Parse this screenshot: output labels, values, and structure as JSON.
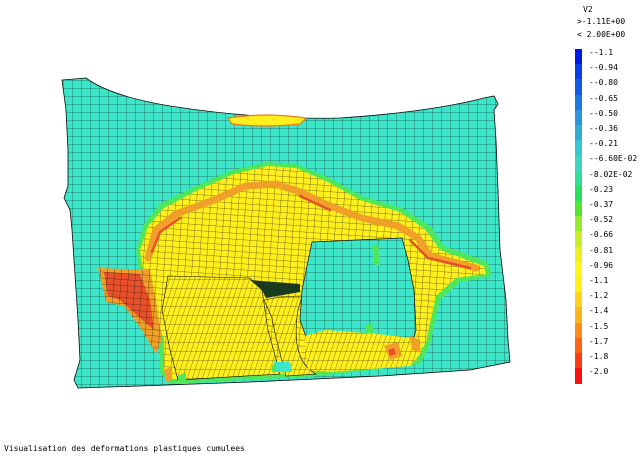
{
  "legend": {
    "variable": "V2",
    "min_label": ">-1.11E+00",
    "max_label": "< 2.00E+00",
    "levels": [
      {
        "label": "-1.1",
        "color": "#0019e6"
      },
      {
        "label": "-0.94",
        "color": "#0a3ee6"
      },
      {
        "label": "-0.80",
        "color": "#1659e6"
      },
      {
        "label": "-0.65",
        "color": "#1f78e0"
      },
      {
        "label": "-0.50",
        "color": "#2b94db"
      },
      {
        "label": "-0.36",
        "color": "#33acd3"
      },
      {
        "label": "-0.21",
        "color": "#35c7d2"
      },
      {
        "label": "-6.60E-02",
        "color": "#3ed6c0"
      },
      {
        "label": "8.02E-02",
        "color": "#2fe096"
      },
      {
        "label": "0.23",
        "color": "#26e060"
      },
      {
        "label": "0.37",
        "color": "#52e632"
      },
      {
        "label": "0.52",
        "color": "#96ea2c"
      },
      {
        "label": "0.66",
        "color": "#c9ee28"
      },
      {
        "label": "0.81",
        "color": "#ebf024"
      },
      {
        "label": "0.96",
        "color": "#fff51e"
      },
      {
        "label": "1.1",
        "color": "#fff01a"
      },
      {
        "label": "1.2",
        "color": "#ffd21a"
      },
      {
        "label": "1.4",
        "color": "#ffb41a"
      },
      {
        "label": "1.5",
        "color": "#ff8c19"
      },
      {
        "label": "1.7",
        "color": "#ff6414"
      },
      {
        "label": "1.8",
        "color": "#ff3c14"
      },
      {
        "label": "2.0",
        "color": "#ff1010"
      }
    ]
  },
  "caption": "Visualisation des deformations plastiques cumulees",
  "colors": {
    "cyan": "#3ce6c8",
    "yellow": "#ffef1c",
    "orange": "#f0a028",
    "red": "#e8502a",
    "green": "#4ee65a",
    "mesh": "#0a0a0a"
  }
}
